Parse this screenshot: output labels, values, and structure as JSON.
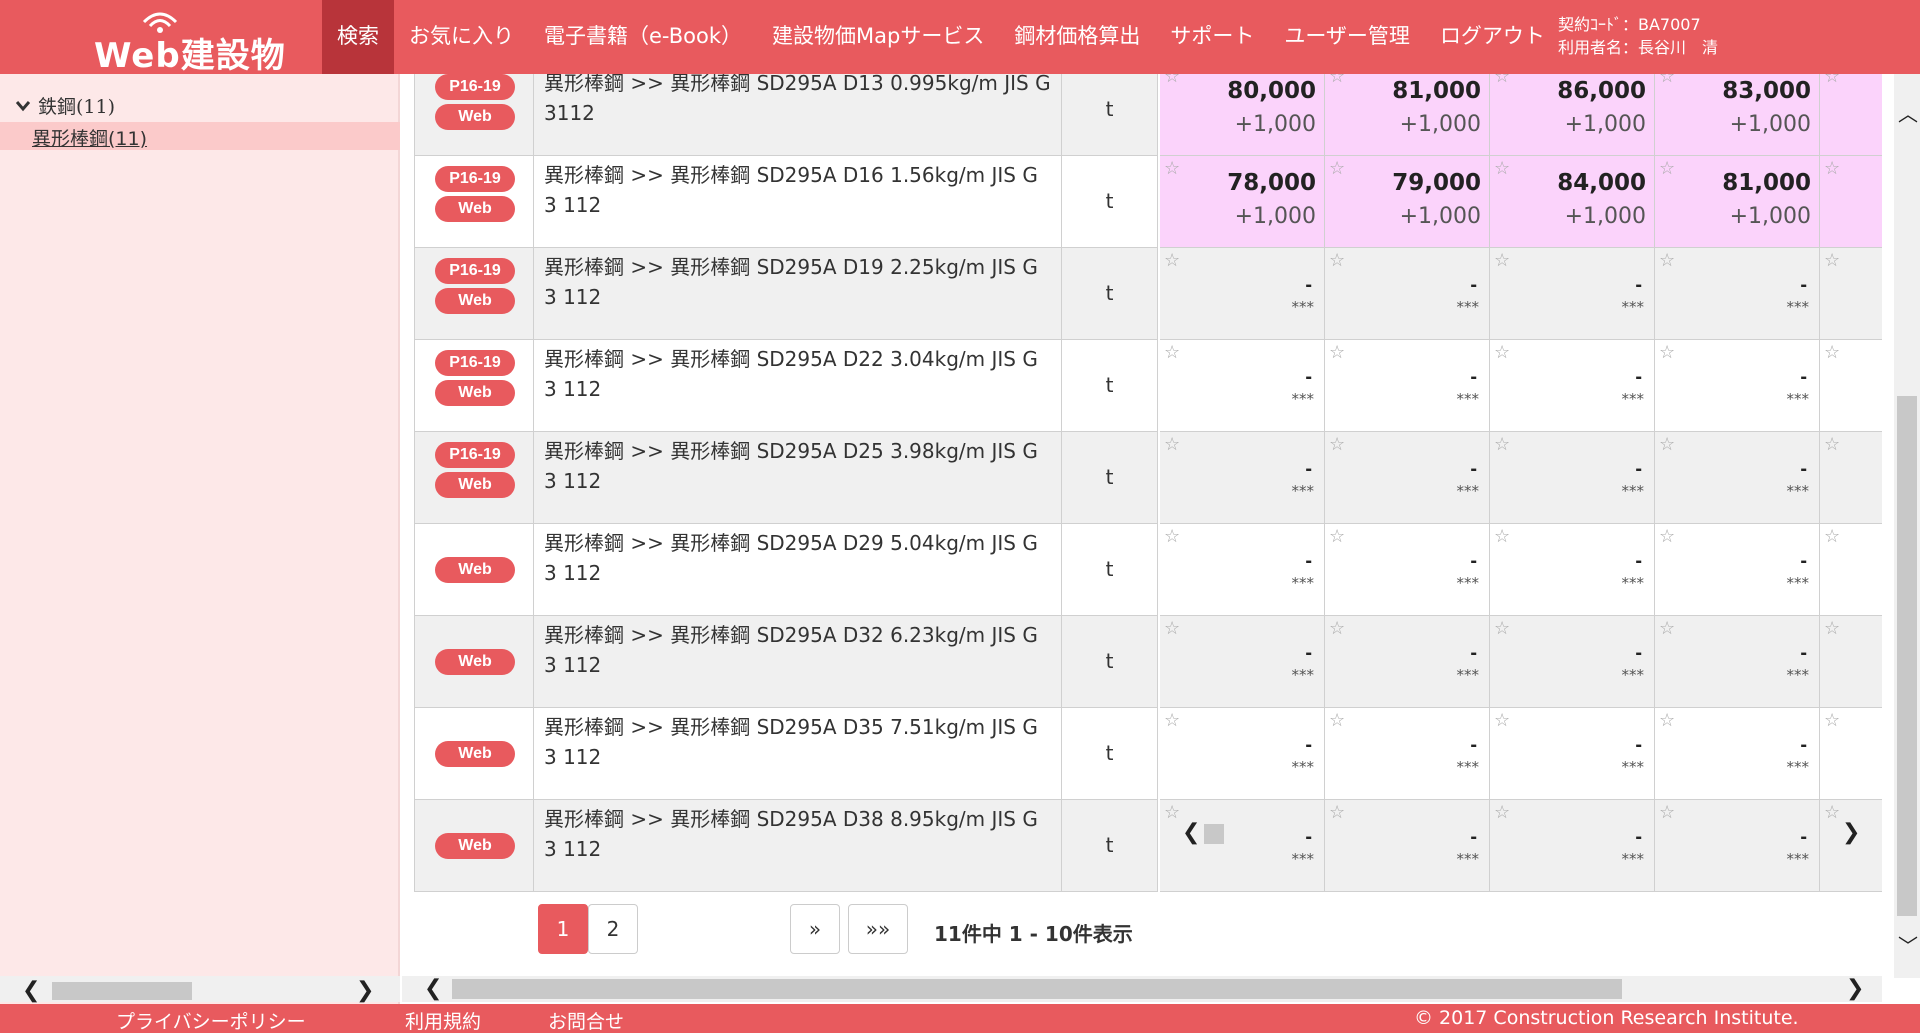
{
  "header": {
    "logo_text": "Web建設物価",
    "nav": [
      "検索",
      "お気に入り",
      "電子書籍（e-Book）",
      "建設物価Mapサービス",
      "鋼材価格算出",
      "サポート",
      "ユーザー管理",
      "ログアウト"
    ],
    "contract_code": "契約ｺｰﾄﾞ：BA7007",
    "user_name": "利用者名：長谷川　清"
  },
  "sidebar": {
    "parent": "鉄鋼(11)",
    "child": "異形棒鋼(11)"
  },
  "rows": [
    {
      "tags": [
        "P16-19",
        "Web"
      ],
      "name": "異形棒鋼 >> 異形棒鋼 SD295A D13 0.995kg/m JIS G 3112",
      "unit": "t",
      "prices": [
        [
          "80,000",
          "+1,000"
        ],
        [
          "81,000",
          "+1,000"
        ],
        [
          "86,000",
          "+1,000"
        ],
        [
          "83,000",
          "+1,000"
        ]
      ]
    },
    {
      "tags": [
        "P16-19",
        "Web"
      ],
      "name": "異形棒鋼 >> 異形棒鋼 SD295A D16 1.56kg/m JIS G 3 112",
      "unit": "t",
      "prices": [
        [
          "78,000",
          "+1,000"
        ],
        [
          "79,000",
          "+1,000"
        ],
        [
          "84,000",
          "+1,000"
        ],
        [
          "81,000",
          "+1,000"
        ]
      ]
    },
    {
      "tags": [
        "P16-19",
        "Web"
      ],
      "name": "異形棒鋼 >> 異形棒鋼 SD295A D19 2.25kg/m JIS G 3 112",
      "unit": "t",
      "prices": null
    },
    {
      "tags": [
        "P16-19",
        "Web"
      ],
      "name": "異形棒鋼 >> 異形棒鋼 SD295A D22 3.04kg/m JIS G 3 112",
      "unit": "t",
      "prices": null
    },
    {
      "tags": [
        "P16-19",
        "Web"
      ],
      "name": "異形棒鋼 >> 異形棒鋼 SD295A D25 3.98kg/m JIS G 3 112",
      "unit": "t",
      "prices": null
    },
    {
      "tags": [
        "Web"
      ],
      "name": "異形棒鋼 >> 異形棒鋼 SD295A D29 5.04kg/m JIS G 3 112",
      "unit": "t",
      "prices": null
    },
    {
      "tags": [
        "Web"
      ],
      "name": "異形棒鋼 >> 異形棒鋼 SD295A D32 6.23kg/m JIS G 3 112",
      "unit": "t",
      "prices": null
    },
    {
      "tags": [
        "Web"
      ],
      "name": "異形棒鋼 >> 異形棒鋼 SD295A D35 7.51kg/m JIS G 3 112",
      "unit": "t",
      "prices": null
    },
    {
      "tags": [
        "Web"
      ],
      "name": "異形棒鋼 >> 異形棒鋼 SD295A D38 8.95kg/m JIS G 3 112",
      "unit": "t",
      "prices": null
    }
  ],
  "empty_price": {
    "value": "-",
    "note": "***"
  },
  "pagination": {
    "pages": [
      "1",
      "2"
    ],
    "next": "»",
    "last": "»»",
    "summary": "11件中 1 - 10件表示"
  },
  "footer": {
    "privacy": "プライバシーポリシー",
    "terms": "利用規約",
    "contact": "お問合せ",
    "copyright": "© 2017 Construction Research Institute."
  },
  "colors": {
    "brand": "#e85a5e",
    "highlight": "#fbd3fb"
  }
}
